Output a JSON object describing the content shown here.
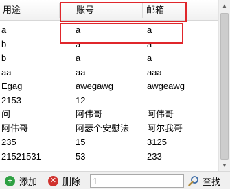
{
  "grid": {
    "headers": [
      "用途",
      "账号",
      "邮箱"
    ],
    "rows": [
      [
        "a",
        "a",
        "a"
      ],
      [
        "b",
        "a",
        "a"
      ],
      [
        "b",
        "a",
        "a"
      ],
      [
        "aa",
        "aa",
        "aaa"
      ],
      [
        "Egag",
        "awegawg",
        "awgeawg"
      ],
      [
        "2153",
        "12",
        ""
      ],
      [
        "问",
        "阿伟哥",
        "阿伟哥"
      ],
      [
        "阿伟哥",
        "阿瑟个安慰法",
        "阿尔我哥"
      ],
      [
        "235",
        "15",
        "3125"
      ],
      [
        "21521531",
        "53",
        "233"
      ]
    ]
  },
  "toolbar": {
    "add_label": "添加",
    "delete_label": "删除",
    "search_value": "1",
    "search_label": "查找"
  },
  "icons": {
    "add": "plus-circle-icon",
    "delete": "x-circle-icon",
    "search": "magnifier-icon"
  },
  "colors": {
    "highlight": "#e0262b",
    "add": "#2ea043",
    "delete": "#d0312d"
  }
}
